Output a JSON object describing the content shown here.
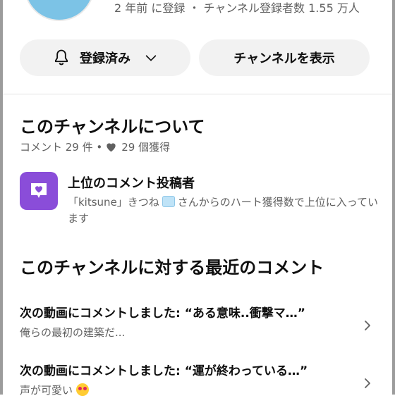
{
  "channel": {
    "meta": "2 年前 に登録 ・ チャンネル登録者数 1.55 万人"
  },
  "actions": {
    "subscribed_label": "登録済み",
    "view_channel_label": "チャンネルを表示"
  },
  "about": {
    "title": "このチャンネルについて",
    "comments_count": "コメント 29 件 •",
    "hearts": "29 個獲得"
  },
  "top_commenter": {
    "title": "上位のコメント投稿者",
    "desc_prefix": "「kitsune」きつね",
    "desc_suffix": "さんからのハート獲得数で上位に入っています"
  },
  "recent": {
    "title": "このチャンネルに対する最近のコメント",
    "items": [
      {
        "title": "次の動画にコメントしました: “ある意味..衝撃マ…”",
        "snippet": "俺らの最初の建築だ..."
      },
      {
        "title": "次の動画にコメントしました: “運が終わっている…”",
        "snippet": "声が可愛い"
      }
    ]
  },
  "icons": {
    "bell": "bell-icon",
    "chevron_down": "chevron-down-icon",
    "heart": "heart-icon",
    "badge": "comment-heart-icon",
    "ice": "ice-cube-emoji",
    "heart_eyes": "heart-eyes-emoji",
    "chevron_right": "chevron-right-icon"
  },
  "colors": {
    "accent_purple": "#8a4dd9",
    "pill_bg": "#f2f2f2",
    "text_secondary": "#606060"
  }
}
